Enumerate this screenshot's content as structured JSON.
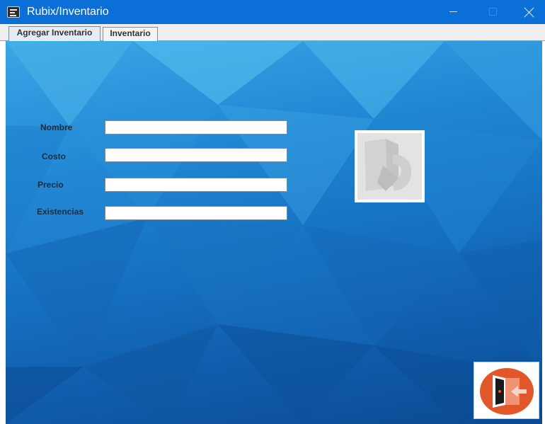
{
  "window": {
    "title": "Rubix/Inventario",
    "title_bar_color": "#0a6fd6"
  },
  "tabs": [
    {
      "label": "Agregar Inventario",
      "selected": true
    },
    {
      "label": "Inventario",
      "selected": false
    }
  ],
  "form": {
    "fields": [
      {
        "label": "Nombre",
        "value": ""
      },
      {
        "label": "Costo",
        "value": ""
      },
      {
        "label": "Precio",
        "value": ""
      },
      {
        "label": "Existencias",
        "value": ""
      }
    ]
  },
  "image_placeholder": {
    "icon": "image-placeholder-icon"
  },
  "exit_button": {
    "icon": "exit-door-icon",
    "accent_color": "#e2572a"
  }
}
